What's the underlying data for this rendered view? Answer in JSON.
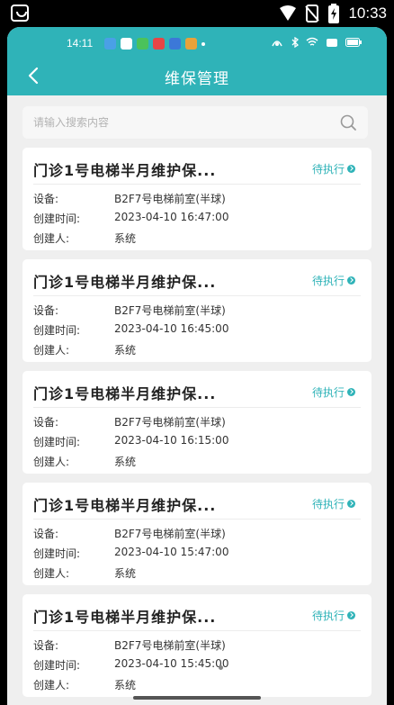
{
  "device_status": {
    "time": "10:33"
  },
  "inner_status": {
    "time": "14:11"
  },
  "header": {
    "title": "维保管理"
  },
  "search": {
    "placeholder": "请输入搜索内容"
  },
  "labels": {
    "device": "设备:",
    "created_time": "创建时间:",
    "creator": "创建人:"
  },
  "records": [
    {
      "title": "门诊1号电梯半月维护保...",
      "status": "待执行",
      "device": "B2F7号电梯前室(半球)",
      "created_time": "2023-04-10 16:47:00",
      "creator": "系统"
    },
    {
      "title": "门诊1号电梯半月维护保...",
      "status": "待执行",
      "device": "B2F7号电梯前室(半球)",
      "created_time": "2023-04-10 16:45:00",
      "creator": "系统"
    },
    {
      "title": "门诊1号电梯半月维护保...",
      "status": "待执行",
      "device": "B2F7号电梯前室(半球)",
      "created_time": "2023-04-10 16:15:00",
      "creator": "系统"
    },
    {
      "title": "门诊1号电梯半月维护保...",
      "status": "待执行",
      "device": "B2F7号电梯前室(半球)",
      "created_time": "2023-04-10 15:47:00",
      "creator": "系统"
    },
    {
      "title": "门诊1号电梯半月维护保...",
      "status": "待执行",
      "device": "B2F7号电梯前室(半球)",
      "created_time": "2023-04-10 15:45:00",
      "creator": "系统"
    }
  ],
  "colors": {
    "accent": "#2fb3b8",
    "background": "#efefef"
  }
}
